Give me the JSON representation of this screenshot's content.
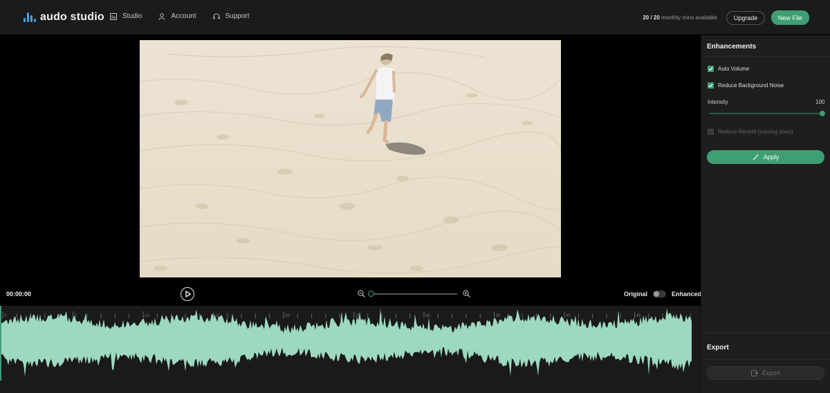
{
  "header": {
    "logo_text": "audo studio",
    "nav": [
      {
        "label": "Studio",
        "icon": "studio-icon"
      },
      {
        "label": "Account",
        "icon": "user-icon"
      },
      {
        "label": "Support",
        "icon": "headset-icon"
      }
    ],
    "minutes_used": "20 / 20",
    "minutes_suffix": "monthly mins available",
    "upgrade_label": "Upgrade",
    "new_file_label": "New File"
  },
  "player": {
    "timecode": "00:00:00",
    "original_label": "Original",
    "enhanced_label": "Enhanced",
    "zoom_level": 0,
    "enhanced_on": false
  },
  "sidebar": {
    "enhancements_title": "Enhancements",
    "options": [
      {
        "label": "Auto Volume",
        "checked": true,
        "disabled": false
      },
      {
        "label": "Reduce Background Noise",
        "checked": true,
        "disabled": false
      },
      {
        "label": "Reduce Reverb (coming soon)",
        "checked": false,
        "disabled": true
      }
    ],
    "intensity_label": "Intensity",
    "intensity_value": "100",
    "apply_label": "Apply",
    "export_title": "Export",
    "export_label": "Export"
  },
  "timeline": {
    "tick_labels": [
      "0",
      "5",
      "10",
      "15",
      "20",
      "25",
      "30",
      "35",
      "40",
      "45"
    ]
  },
  "colors": {
    "accent": "#3f9e73",
    "waveform": "#9dd9c0",
    "logo": "#4aa0e8"
  }
}
